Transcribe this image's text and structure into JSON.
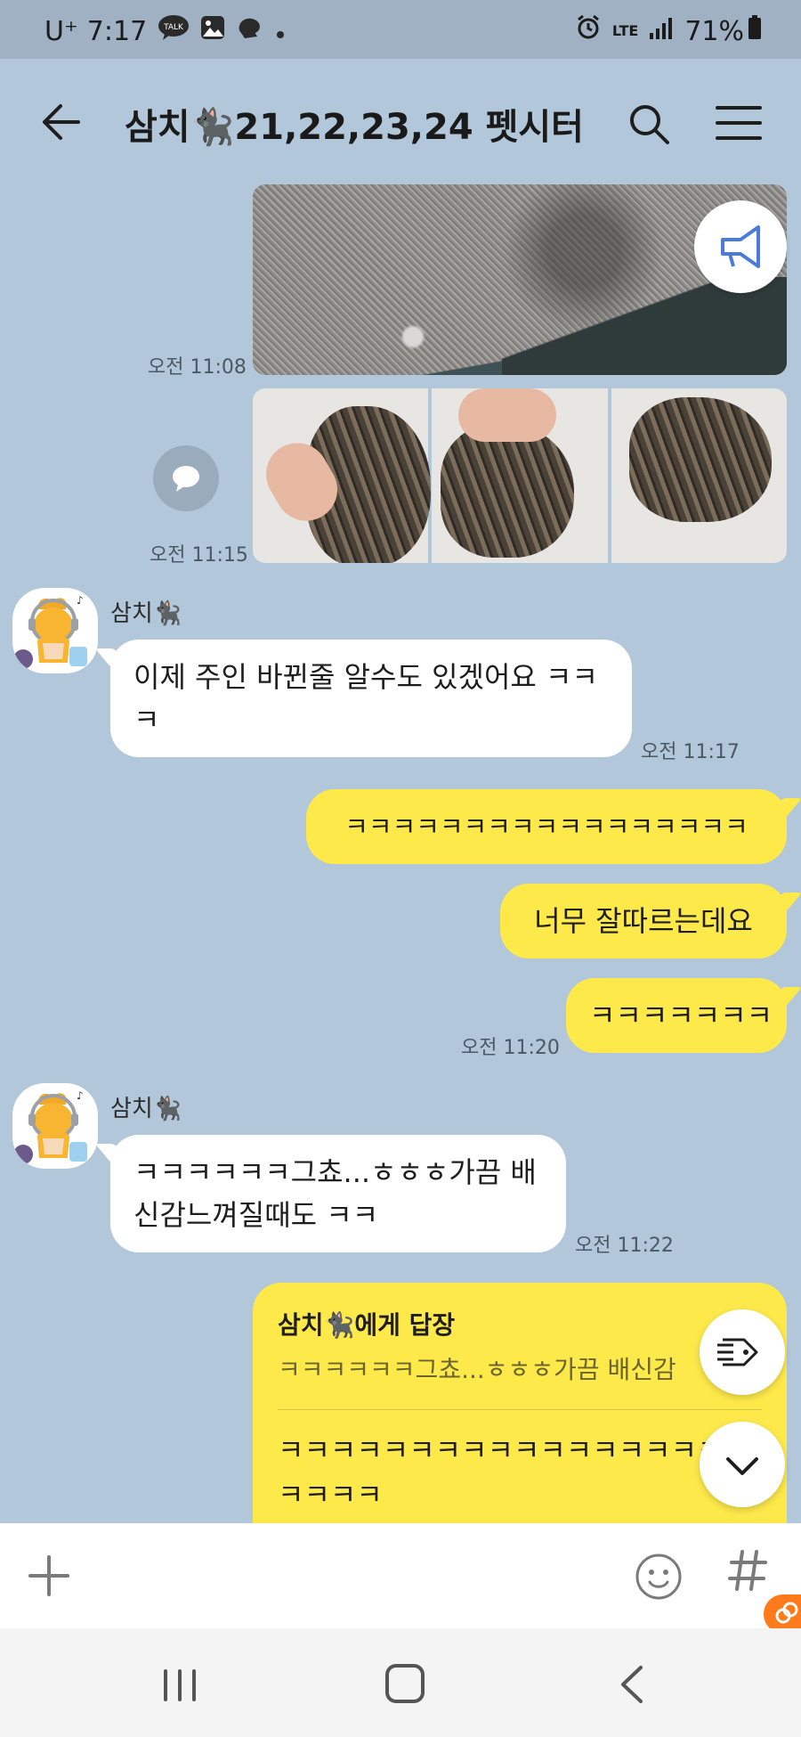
{
  "status_bar": {
    "carrier": "U⁺",
    "time": "7:17",
    "talk_label": "TALK",
    "network": "LTE",
    "battery": "71%"
  },
  "header": {
    "title": "삼치🐈‍⬛21,22,23,24 펫시터"
  },
  "messages": {
    "photo1_time": "오전 11:08",
    "photos2_time": "오전 11:15",
    "sender1": "삼치🐈‍⬛",
    "msg1": "이제 주인 바뀐줄 알수도 있겠어요 ㅋㅋㅋ",
    "msg1_time": "오전 11:17",
    "my1": "ㅋㅋㅋㅋㅋㅋㅋㅋㅋㅋㅋㅋㅋㅋㅋㅋㅋ",
    "my2": "너무 잘따르는데요",
    "my3": "ㅋㅋㅋㅋㅋㅋㅋ",
    "my_time": "오전 11:20",
    "sender2": "삼치🐈‍⬛",
    "msg2": "ㅋㅋㅋㅋㅋㅋ그쵸...ㅎㅎㅎ가끔 배신감느껴질때도 ㅋㅋ",
    "msg2_time": "오전 11:22",
    "reply_title": "삼치🐈‍⬛에게 답장",
    "reply_quote": "ㅋㅋㅋㅋㅋㅋ그쵸...ㅎㅎㅎ가끔 배신감",
    "reply_msg": "ㅋㅋㅋㅋㅋㅋㅋㅋㅋㅋㅋㅋㅋㅋㅋㅋㅋㅋㅋㅋㅋㅋ"
  },
  "colors": {
    "background": "#b2c7da",
    "my_bubble": "#fee94b",
    "other_bubble": "#ffffff"
  }
}
